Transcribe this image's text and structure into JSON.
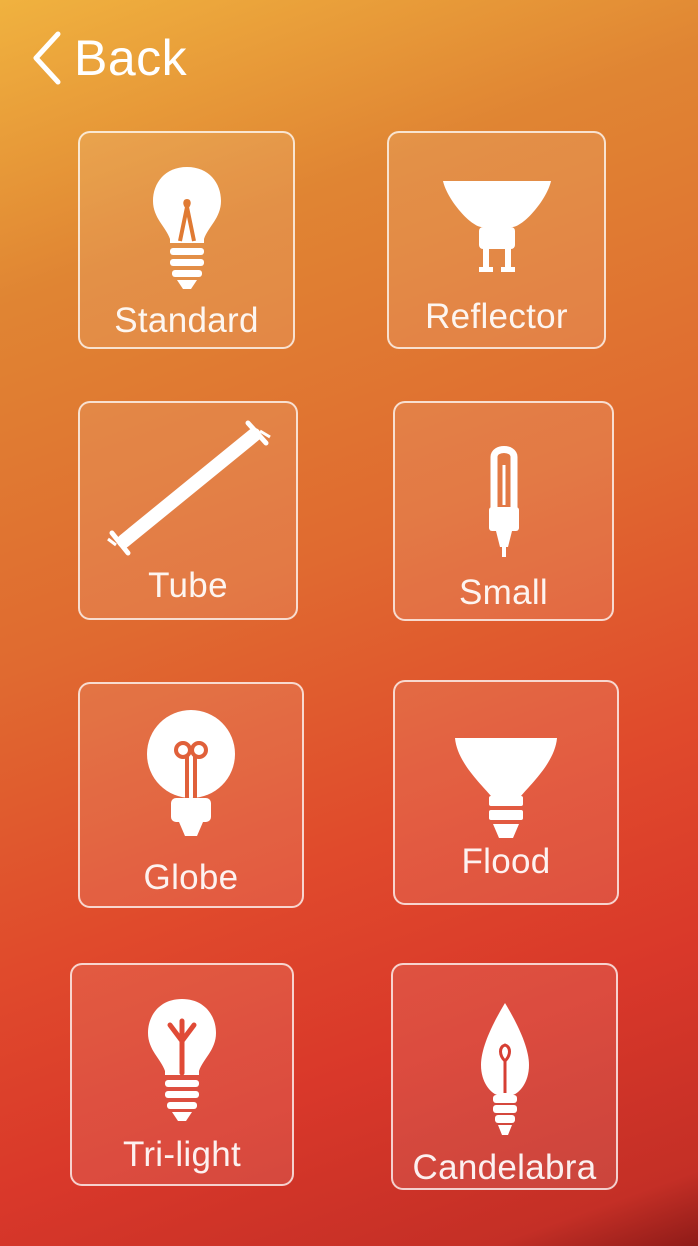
{
  "header": {
    "back_label": "Back",
    "back_icon": "chevron-left-icon"
  },
  "bulb_types": [
    {
      "label": "Standard",
      "icon": "standard-bulb-icon"
    },
    {
      "label": "Reflector",
      "icon": "reflector-bulb-icon"
    },
    {
      "label": "Tube",
      "icon": "tube-bulb-icon"
    },
    {
      "label": "Small",
      "icon": "small-bulb-icon"
    },
    {
      "label": "Globe",
      "icon": "globe-bulb-icon"
    },
    {
      "label": "Flood",
      "icon": "flood-bulb-icon"
    },
    {
      "label": "Tri-light",
      "icon": "tri-light-bulb-icon"
    },
    {
      "label": "Candelabra",
      "icon": "candelabra-bulb-icon"
    }
  ]
}
